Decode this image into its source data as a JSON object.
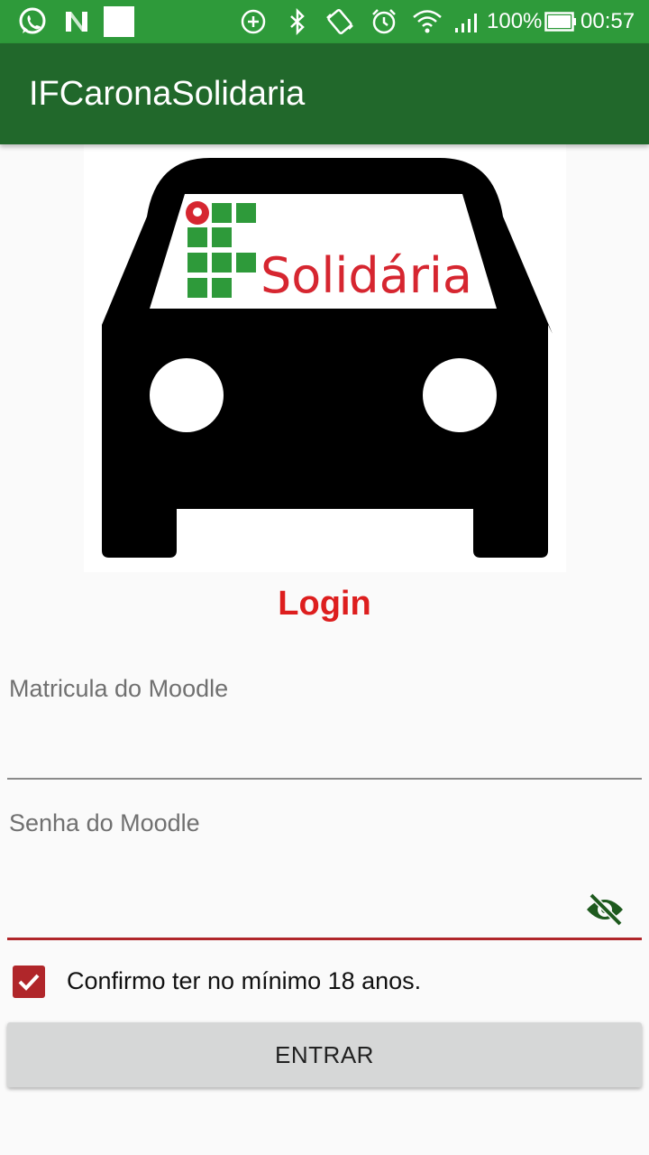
{
  "status_bar": {
    "battery": "100%",
    "time": "00:57",
    "icons": [
      "whatsapp-icon",
      "n-app-icon",
      "blank-notification-icon",
      "data-saver-icon",
      "bluetooth-icon",
      "vibrate-icon",
      "alarm-icon",
      "wifi-icon",
      "signal-icon",
      "battery-icon"
    ]
  },
  "app_bar": {
    "title": "IFCaronaSolidaria"
  },
  "logo": {
    "text": "Solidária",
    "description_icon": "car-logo-icon"
  },
  "login": {
    "title": "Login",
    "username_label": "Matricula do Moodle",
    "username_value": "",
    "password_label": "Senha do Moodle",
    "password_value": "",
    "age_confirm_label": "Confirmo ter no mínimo 18 anos.",
    "age_confirm_checked": true,
    "submit_label": "ENTRAR"
  },
  "colors": {
    "status_bar": "#2e9a3a",
    "app_bar": "#21682b",
    "accent_red": "#dd1e1e",
    "checkbox": "#b0262a",
    "eye_icon": "#1e5a1e",
    "logo_green": "#2e9a3a",
    "logo_red": "#d62630"
  }
}
